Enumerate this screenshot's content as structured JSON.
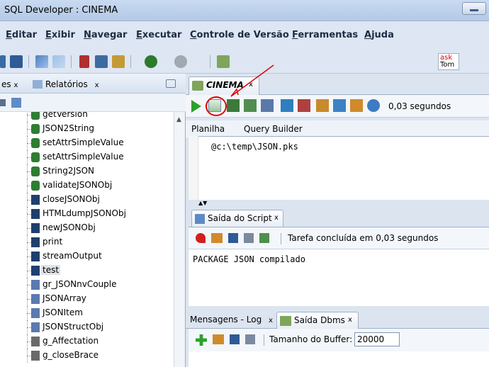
{
  "window": {
    "title": "SQL Developer : CINEMA"
  },
  "menu": [
    {
      "label": "Editar",
      "u": "E",
      "rest": "ditar"
    },
    {
      "label": "Exibir",
      "u": "E",
      "rest": "xibir"
    },
    {
      "label": "Navegar",
      "u": "N",
      "rest": "avegar"
    },
    {
      "label": "Executar",
      "u": "E",
      "rest": "xecutar"
    },
    {
      "label": "Controle de Versão",
      "u": "C",
      "rest": "ontrole de Versão"
    },
    {
      "label": "Ferramentas",
      "u": "F",
      "rest": "erramentas"
    },
    {
      "label": "Ajuda",
      "u": "A",
      "rest": "juda"
    }
  ],
  "left": {
    "tab1": "es",
    "tab2": "Relatórios",
    "tree": [
      {
        "label": "getVersion",
        "type": "func"
      },
      {
        "label": "JSON2String",
        "type": "func"
      },
      {
        "label": "setAttrSimpleValue",
        "type": "func"
      },
      {
        "label": "setAttrSimpleValue",
        "type": "func"
      },
      {
        "label": "String2JSON",
        "type": "func"
      },
      {
        "label": "validateJSONObj",
        "type": "func"
      },
      {
        "label": "closeJSONObj",
        "type": "proc"
      },
      {
        "label": "HTMLdumpJSONObj",
        "type": "proc"
      },
      {
        "label": "newJSONObj",
        "type": "proc"
      },
      {
        "label": "print",
        "type": "proc"
      },
      {
        "label": "streamOutput",
        "type": "proc"
      },
      {
        "label": "test",
        "type": "proc",
        "selected": true
      },
      {
        "label": "gr_JSONnvCouple",
        "type": "type"
      },
      {
        "label": "JSONArray",
        "type": "type"
      },
      {
        "label": "JSONItem",
        "type": "type"
      },
      {
        "label": "JSONStructObj",
        "type": "type"
      },
      {
        "label": "g_Affectation",
        "type": "var"
      },
      {
        "label": "g_closeBrace",
        "type": "var"
      }
    ]
  },
  "editor": {
    "tab": "CINEMA",
    "timing": "0,03 segundos",
    "subtabs": [
      "Planilha",
      "Query Builder"
    ],
    "code": "@c:\\temp\\JSON.pks"
  },
  "script_output": {
    "tab": "Saída do Script",
    "status": "Tarefa concluída em 0,03 segundos",
    "text": "PACKAGE JSON compilado"
  },
  "bottom": {
    "tab1": "Mensagens - Log",
    "tab2": "Saída Dbms",
    "buffer_label": "Tamanho do Buffer:",
    "buffer_value": "20000"
  },
  "ask_widget": {
    "line1": "ask",
    "line2": "Tom"
  },
  "colors": {
    "accent": "#1a4f9c",
    "red_mark": "#e00000",
    "run_green": "#2ca02c"
  }
}
